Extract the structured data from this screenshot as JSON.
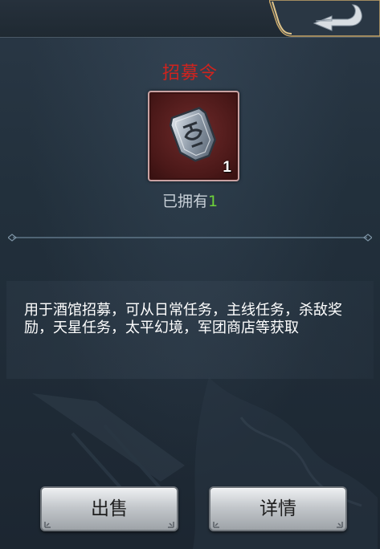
{
  "item": {
    "name": "招募令",
    "count": "1",
    "icon": "recruit-token-icon"
  },
  "owned": {
    "label": "已拥有",
    "value": "1"
  },
  "description": "用于酒馆招募，可从日常任务，主线任务，杀敌奖励，天星任务，太平幻境，军团商店等获取",
  "buttons": {
    "sell": "出售",
    "detail": "详情"
  },
  "colors": {
    "title": "#d0231e",
    "owned_value": "#6ed23a",
    "slot_border": "#c9a2a2"
  }
}
